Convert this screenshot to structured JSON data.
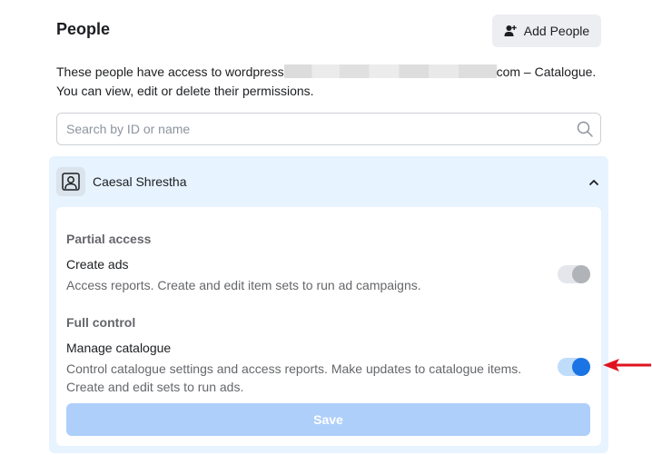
{
  "header": {
    "title": "People",
    "add_people_label": "Add People"
  },
  "description": {
    "prefix": "These people have access to wordpress",
    "suffix": "com – Catalogue.",
    "line2": "You can view, edit or delete their permissions."
  },
  "search": {
    "placeholder": "Search by ID or name",
    "value": ""
  },
  "person": {
    "name": "Caesal Shrestha",
    "expanded": true,
    "sections": [
      {
        "label": "Partial access",
        "permission": "Create ads",
        "description": "Access reports. Create and edit item sets to run ad campaigns.",
        "enabled": false
      },
      {
        "label": "Full control",
        "permission": "Manage catalogue",
        "description_line1": "Control catalogue settings and access reports. Make updates to catalogue items.",
        "description_line2": "Create and edit sets to run ads.",
        "enabled": true
      }
    ],
    "save_label": "Save"
  },
  "colors": {
    "accent": "#1b74e4",
    "card_background": "#e7f3ff",
    "save_disabled": "#aecffa",
    "arrow": "#e0141e"
  },
  "icons": [
    "add-person-icon",
    "search-icon",
    "user-avatar-icon",
    "chevron-up-icon",
    "red-arrow-icon"
  ]
}
